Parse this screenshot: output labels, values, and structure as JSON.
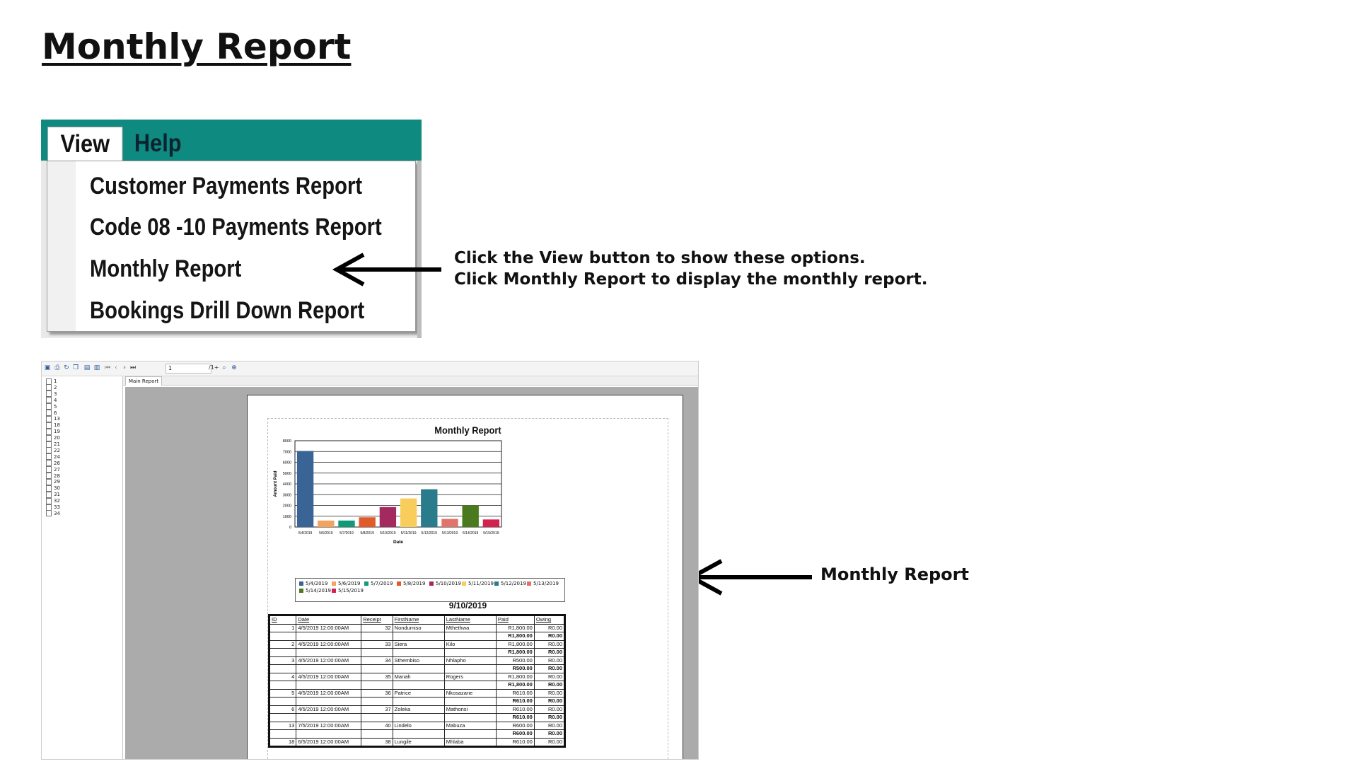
{
  "page": {
    "title": "Monthly Report"
  },
  "menu": {
    "tabs": [
      "View",
      "Help"
    ],
    "items": [
      "Customer Payments Report",
      "Code 08 -10 Payments Report",
      "Monthly Report",
      "Bookings Drill Down Report"
    ],
    "colors": {
      "menubar": "#0f8a80"
    }
  },
  "instructions": {
    "line1": "Click the View button to show these options.",
    "line2": "Click Monthly Report to display the monthly report."
  },
  "caption": "Monthly Report",
  "viewer": {
    "toolbar": {
      "page_value": "1",
      "page_total": "/1+"
    },
    "tab_label": "Main Report",
    "tree_items": [
      "1",
      "2",
      "3",
      "4",
      "5",
      "6",
      "13",
      "18",
      "19",
      "20",
      "21",
      "22",
      "24",
      "26",
      "27",
      "28",
      "29",
      "30",
      "31",
      "32",
      "33",
      "34"
    ],
    "report": {
      "title": "Monthly Report",
      "date": "9/10/2019",
      "table": {
        "headers": [
          "ID",
          "Date",
          "Receipt",
          "FirstName",
          "LastName",
          "Paid",
          "Owing"
        ],
        "rows": [
          {
            "id": "1",
            "date": "4/5/2019 12:00:00AM",
            "receipt": "32",
            "first": "Nondumiso",
            "last": "Mthethwa",
            "paid": "R1,800.00",
            "owing": "R0.00",
            "paid_total": "R1,800.00",
            "owing_total": "R0.00"
          },
          {
            "id": "2",
            "date": "4/5/2019 12:00:00AM",
            "receipt": "33",
            "first": "Siera",
            "last": "Kilo",
            "paid": "R1,800.00",
            "owing": "R0.00",
            "paid_total": "R1,800.00",
            "owing_total": "R0.00"
          },
          {
            "id": "3",
            "date": "4/5/2019 12:00:00AM",
            "receipt": "34",
            "first": "Sthembiso",
            "last": "Nhlapho",
            "paid": "R500.00",
            "owing": "R0.00",
            "paid_total": "R500.00",
            "owing_total": "R0.00"
          },
          {
            "id": "4",
            "date": "4/5/2019 12:00:00AM",
            "receipt": "35",
            "first": "Manah",
            "last": "Rogers",
            "paid": "R1,800.00",
            "owing": "R0.00",
            "paid_total": "R1,800.00",
            "owing_total": "R0.00"
          },
          {
            "id": "5",
            "date": "4/5/2019 12:00:00AM",
            "receipt": "36",
            "first": "Patrice",
            "last": "Nkosazane",
            "paid": "R610.00",
            "owing": "R0.00",
            "paid_total": "R610.00",
            "owing_total": "R0.00"
          },
          {
            "id": "6",
            "date": "4/5/2019 12:00:00AM",
            "receipt": "37",
            "first": "Zoleka",
            "last": "Mathonsi",
            "paid": "R610.00",
            "owing": "R0.00",
            "paid_total": "R610.00",
            "owing_total": "R0.00"
          },
          {
            "id": "13",
            "date": "7/5/2019 12:00:00AM",
            "receipt": "40",
            "first": "Lindelo",
            "last": "Mabuza",
            "paid": "R600.00",
            "owing": "R0.00",
            "paid_total": "R600.00",
            "owing_total": "R0.00"
          },
          {
            "id": "18",
            "date": "6/5/2019 12:00:00AM",
            "receipt": "38",
            "first": "Lungile",
            "last": "Mhlaba",
            "paid": "R610.00",
            "owing": "R0.00"
          }
        ]
      }
    }
  },
  "chart_data": {
    "type": "bar",
    "title": "Monthly Report",
    "xlabel": "Date",
    "ylabel": "Amount Paid",
    "ylim": [
      0,
      8000
    ],
    "yticks": [
      0,
      1000,
      2000,
      3000,
      4000,
      5000,
      6000,
      7000,
      8000
    ],
    "categories": [
      "5/4/2019",
      "5/6/2019",
      "5/7/2019",
      "5/8/2019",
      "5/10/2019",
      "5/11/2019",
      "5/12/2019",
      "5/13/2019",
      "5/14/2019",
      "5/15/2019"
    ],
    "values": [
      7050,
      600,
      600,
      900,
      1850,
      2650,
      3500,
      750,
      2000,
      700
    ],
    "colors": [
      "#3a6496",
      "#f2a35e",
      "#119a77",
      "#e05a2a",
      "#a3295f",
      "#f9cd5c",
      "#2a7b8c",
      "#e0736a",
      "#4a7a1d",
      "#d4224e"
    ],
    "grid": true,
    "legend": "bottom",
    "legend_entries": [
      "5/4/2019",
      "5/6/2019",
      "5/7/2019",
      "5/8/2019",
      "5/10/2019",
      "5/11/2019",
      "5/12/2019",
      "5/13/2019",
      "5/14/2019",
      "5/15/2019"
    ]
  }
}
